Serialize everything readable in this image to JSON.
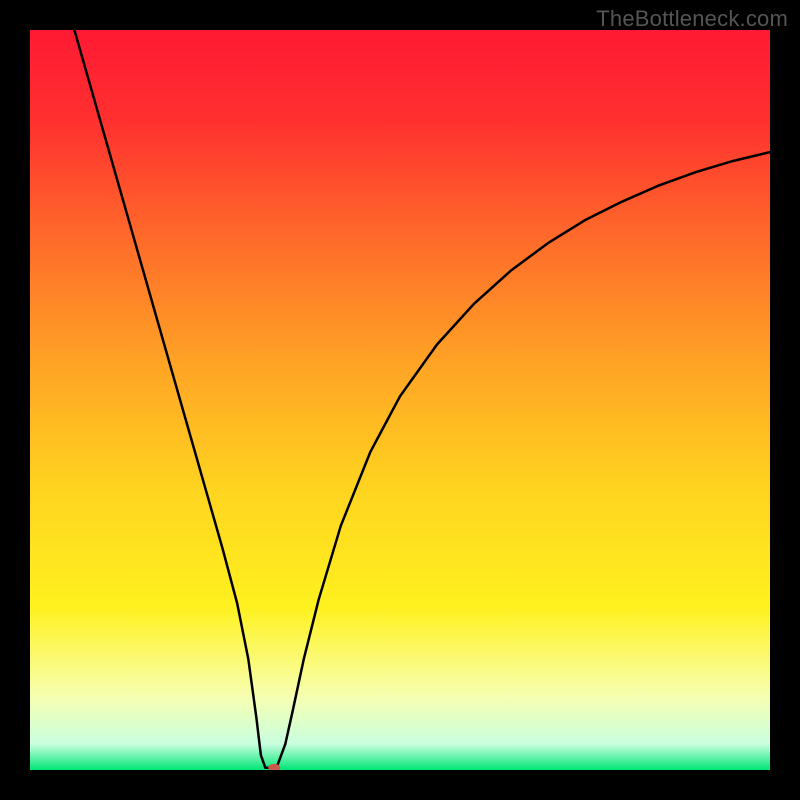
{
  "watermark": "TheBottleneck.com",
  "chart_data": {
    "type": "line",
    "title": "",
    "xlabel": "",
    "ylabel": "",
    "xlim": [
      0,
      100
    ],
    "ylim": [
      0,
      100
    ],
    "background_gradient": {
      "stops": [
        {
          "offset": 0.0,
          "color": "#ff1a33"
        },
        {
          "offset": 0.12,
          "color": "#ff2f2f"
        },
        {
          "offset": 0.28,
          "color": "#ff6a2a"
        },
        {
          "offset": 0.45,
          "color": "#ffa325"
        },
        {
          "offset": 0.62,
          "color": "#ffd41f"
        },
        {
          "offset": 0.78,
          "color": "#fff11f"
        },
        {
          "offset": 0.9,
          "color": "#f7ffb0"
        },
        {
          "offset": 0.965,
          "color": "#c9ffdf"
        },
        {
          "offset": 1.0,
          "color": "#00e676"
        }
      ]
    },
    "series": [
      {
        "name": "curve",
        "color": "#000000",
        "width": 2.5,
        "x": [
          6.0,
          8,
          10,
          12,
          14,
          16,
          18,
          20,
          22,
          24,
          26,
          28,
          29.5,
          30.6,
          31.2,
          31.8,
          32.4,
          33.0,
          33.5,
          34.5,
          35.5,
          37,
          39,
          42,
          46,
          50,
          55,
          60,
          65,
          70,
          75,
          80,
          85,
          90,
          95,
          100
        ],
        "y": [
          100,
          93.0,
          86.0,
          79.0,
          72.0,
          65.0,
          58.0,
          51.0,
          44.0,
          37.0,
          30.0,
          22.5,
          15.0,
          7.0,
          2.0,
          0.3,
          0.3,
          0.3,
          0.8,
          3.5,
          8.0,
          15.0,
          23.0,
          33.0,
          43.0,
          50.5,
          57.5,
          63.0,
          67.5,
          71.2,
          74.3,
          76.8,
          79.0,
          80.8,
          82.3,
          83.5
        ]
      }
    ],
    "marker": {
      "x": 33.0,
      "y": 0.3,
      "color": "#c75a4a",
      "rx": 6,
      "ry": 4
    }
  }
}
